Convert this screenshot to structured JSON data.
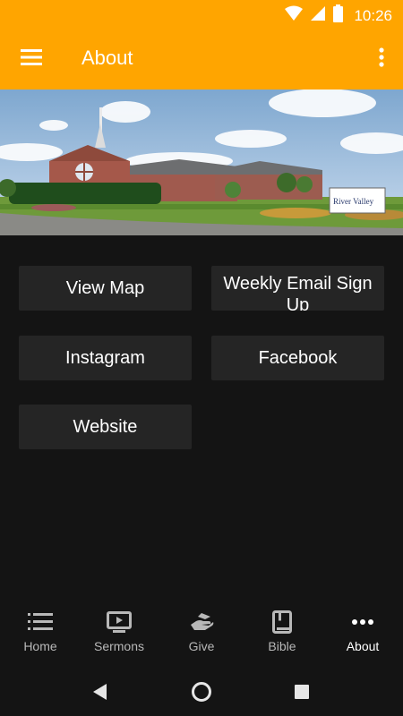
{
  "status_bar": {
    "time": "10:26",
    "icons": [
      "wifi-icon",
      "signal-icon",
      "battery-icon"
    ],
    "color": "#ffa500"
  },
  "app_bar": {
    "title": "About",
    "menu_icon": "hamburger-menu-icon",
    "overflow_icon": "more-vert-icon",
    "color": "#ffa500"
  },
  "hero": {
    "sign_text": "River Valley"
  },
  "links": [
    {
      "label": "View Map"
    },
    {
      "label": "Weekly Email Sign Up"
    },
    {
      "label": "Instagram"
    },
    {
      "label": "Facebook"
    },
    {
      "label": "Website"
    }
  ],
  "bottom_nav": {
    "items": [
      {
        "label": "Home",
        "icon": "list-icon",
        "active": false
      },
      {
        "label": "Sermons",
        "icon": "play-screen-icon",
        "active": false
      },
      {
        "label": "Give",
        "icon": "giving-hand-icon",
        "active": false
      },
      {
        "label": "Bible",
        "icon": "book-icon",
        "active": false
      },
      {
        "label": "About",
        "icon": "more-horiz-icon",
        "active": true
      }
    ]
  },
  "system_nav": [
    "back-icon",
    "home-icon",
    "recents-icon"
  ],
  "colors": {
    "accent": "#ffa500",
    "background": "#141414",
    "tile": "#252525",
    "text": "#ffffff",
    "inactive": "#b8b8b8"
  }
}
